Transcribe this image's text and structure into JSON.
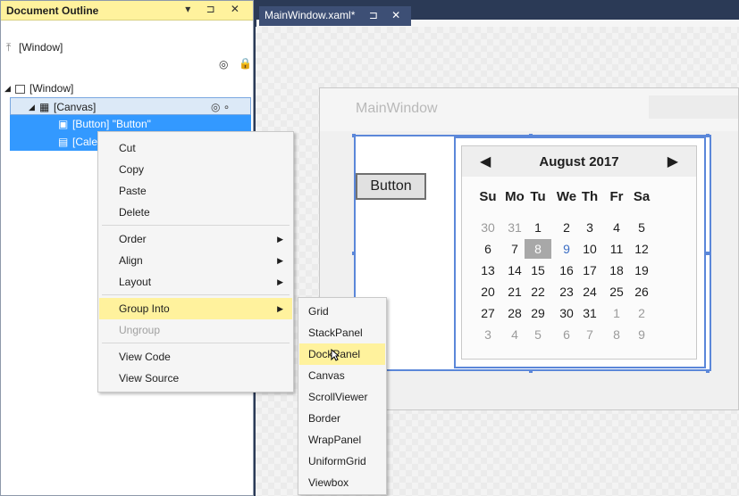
{
  "outline": {
    "title": "Document Outline",
    "tools": "▾ ⊐ ✕",
    "window_top": "[Window]",
    "tree": {
      "window": "[Window]",
      "canvas": "[Canvas]",
      "button": "[Button] \"Button\"",
      "calendar": "[Cale"
    }
  },
  "tab": {
    "label": "MainWindow.xaml*",
    "pin": "⊐",
    "close": "✕"
  },
  "main_window": {
    "title": "MainWindow",
    "button_label": "Button",
    "calendar": {
      "title": "August 2017",
      "prev": "◀",
      "next": "▶",
      "days_of_week": [
        "Su",
        "Mo",
        "Tu",
        "We",
        "Th",
        "Fr",
        "Sa"
      ],
      "weeks": [
        [
          "30",
          "31",
          "1",
          "2",
          "3",
          "4",
          "5"
        ],
        [
          "6",
          "7",
          "8",
          "9",
          "10",
          "11",
          "12"
        ],
        [
          "13",
          "14",
          "15",
          "16",
          "17",
          "18",
          "19"
        ],
        [
          "20",
          "21",
          "22",
          "23",
          "24",
          "25",
          "26"
        ],
        [
          "27",
          "28",
          "29",
          "30",
          "31",
          "1",
          "2"
        ],
        [
          "3",
          "4",
          "5",
          "6",
          "7",
          "8",
          "9"
        ]
      ],
      "today": "8"
    }
  },
  "context_menu": {
    "items": [
      "Cut",
      "Copy",
      "Paste",
      "Delete",
      "Order",
      "Align",
      "Layout",
      "Group Into",
      "Ungroup",
      "View Code",
      "View Source"
    ],
    "highlighted": "Group Into",
    "disabled": "Ungroup"
  },
  "submenu": {
    "items": [
      "Grid",
      "StackPanel",
      "DockPanel",
      "Canvas",
      "ScrollViewer",
      "Border",
      "WrapPanel",
      "UniformGrid",
      "Viewbox"
    ],
    "highlighted": "DockPanel"
  },
  "colors": {
    "title_yellow": "#fff29d",
    "selection_blue": "#3399ff",
    "dark_chrome": "#2b3a56",
    "adorner_blue": "#5b87d9"
  }
}
